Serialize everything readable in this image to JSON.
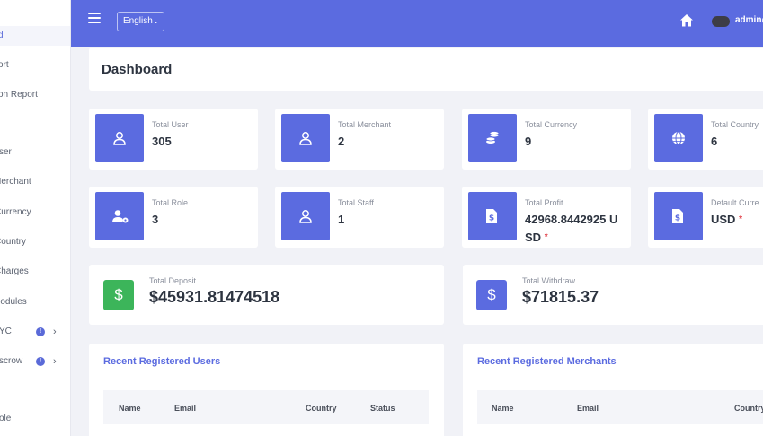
{
  "sidebar": {
    "items": [
      {
        "label": "d",
        "active": true,
        "badge": "",
        "chevron": ""
      },
      {
        "label": "ort",
        "active": false,
        "badge": "",
        "chevron": ""
      },
      {
        "label": "on Report",
        "active": false,
        "badge": "",
        "chevron": ""
      },
      {
        "label": "ser",
        "active": false,
        "badge": "",
        "chevron": ""
      },
      {
        "label": "Merchant",
        "active": false,
        "badge": "",
        "chevron": ""
      },
      {
        "label": "Currency",
        "active": false,
        "badge": "",
        "chevron": ""
      },
      {
        "label": "Country",
        "active": false,
        "badge": "",
        "chevron": ""
      },
      {
        "label": "Charges",
        "active": false,
        "badge": "",
        "chevron": ""
      },
      {
        "label": "Modules",
        "active": false,
        "badge": "",
        "chevron": ""
      },
      {
        "label": "YC",
        "active": false,
        "badge": "!",
        "chevron": "›"
      },
      {
        "label": "scrow",
        "active": false,
        "badge": "!",
        "chevron": "›"
      },
      {
        "label": "ole",
        "active": false,
        "badge": "",
        "chevron": ""
      }
    ]
  },
  "topbar": {
    "language": "English",
    "language_chevron": "⌄",
    "admin_name": "admin@",
    "accent": "#5b6be0"
  },
  "page": {
    "title": "Dashboard"
  },
  "stats": [
    {
      "label": "Total User",
      "value": "305",
      "icon": "user-icon"
    },
    {
      "label": "Total Merchant",
      "value": "2",
      "icon": "user-icon"
    },
    {
      "label": "Total Currency",
      "value": "9",
      "icon": "coins-icon"
    },
    {
      "label": "Total Country",
      "value": "6",
      "icon": "globe-icon"
    },
    {
      "label": "Total Role",
      "value": "3",
      "icon": "user-gear-icon"
    },
    {
      "label": "Total Staff",
      "value": "1",
      "icon": "user-icon"
    },
    {
      "label": "Total Profit",
      "value": "42968.8442925 USD",
      "required": "*",
      "icon": "dollar-file-icon"
    },
    {
      "label": "Default Curre",
      "value": "USD",
      "required": "*",
      "icon": "dollar-file-icon"
    }
  ],
  "deposit": {
    "label": "Total Deposit",
    "value": "$45931.81474518",
    "icon_glyph": "$",
    "color": "#3cb55a"
  },
  "withdraw": {
    "label": "Total Withdraw",
    "value": "$71815.37",
    "icon_glyph": "$",
    "color": "#5b6be0"
  },
  "recent_users": {
    "title": "Recent Registered Users",
    "columns": [
      "Name",
      "Email",
      "Country",
      "Status"
    ]
  },
  "recent_merchants": {
    "title": "Recent Registered Merchants",
    "columns": [
      "Name",
      "Email",
      "Country"
    ]
  }
}
